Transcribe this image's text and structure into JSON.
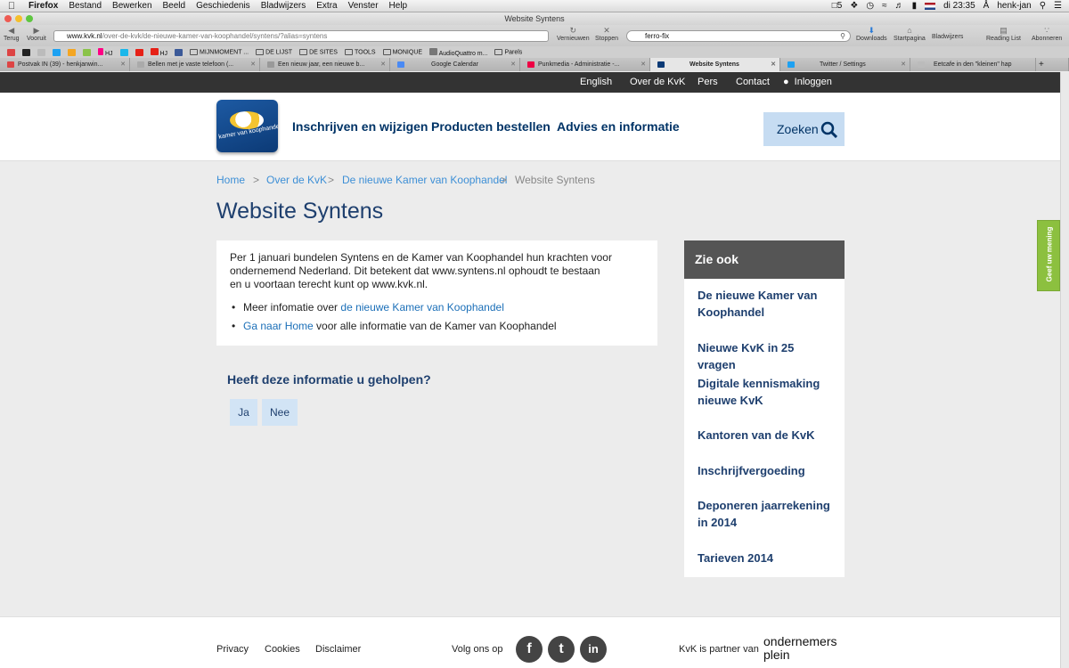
{
  "menubar": {
    "apple": "",
    "items": [
      "Firefox",
      "Bestand",
      "Bewerken",
      "Beeld",
      "Geschiedenis",
      "Bladwijzers",
      "Extra",
      "Venster",
      "Help"
    ],
    "adobe": "5",
    "clock": "di 23:35",
    "user": "henk-jan"
  },
  "window": {
    "title": "Website Syntens"
  },
  "toolbar": {
    "back": "Terug",
    "forward": "Vooruit",
    "url_domain": "www.kvk.nl",
    "url_path": "/over-de-kvk/de-nieuwe-kamer-van-koophandel/syntens/?alias=syntens",
    "reload": "Vernieuwen",
    "stop": "Stoppen",
    "search_value": "ferro-fix",
    "downloads": "Downloads",
    "home": "Startpagina",
    "bookmarks": "Bladwijzers",
    "reading_list": "Reading List",
    "subscribe": "Abonneren"
  },
  "bookmarks_bar": [
    "HJ",
    "HJ",
    "MIJNMOMENT ...",
    "DE LIJST",
    "DE SITES",
    "TOOLS",
    "MONIQUE",
    "AudioQuattro m...",
    "Parels"
  ],
  "tabs": [
    "Postvak IN (39) - henkjanwin...",
    "Bellen met je vaste telefoon (...",
    "Een nieuw jaar, een nieuwe b...",
    "Google Calendar",
    "Punkmedia - Administratie -...",
    "Website Syntens",
    "Twitter / Settings",
    "Eetcafe in den \"kleinen\" hap"
  ],
  "topbar": {
    "english": "English",
    "about": "Over de KvK",
    "press": "Pers",
    "contact": "Contact",
    "login": "Inloggen"
  },
  "logo_text": "kamer van koophandel",
  "nav": {
    "register": "Inschrijven en wijzigen",
    "products": "Producten bestellen",
    "advice": "Advies en informatie",
    "search": "Zoeken"
  },
  "breadcrumb": {
    "home": "Home",
    "about": "Over de KvK",
    "new_kvk": "De nieuwe Kamer van Koophandel",
    "current": "Website Syntens",
    "sep": ">"
  },
  "page_title": "Website Syntens",
  "content": {
    "intro": "Per 1 januari bundelen Syntens en de Kamer van Koophandel hun krachten voor ondernemend Nederland. Dit betekent dat www.syntens.nl ophoudt te bestaan en u voortaan terecht kunt op www.kvk.nl.",
    "bullet1_prefix": "Meer infomatie over ",
    "bullet1_link": "de nieuwe Kamer van Koophandel",
    "bullet2_link": "Ga naar Home",
    "bullet2_suffix": " voor alle informatie van de Kamer van Koophandel"
  },
  "helpful": {
    "question": "Heeft deze informatie u geholpen?",
    "yes": "Ja",
    "no": "Nee"
  },
  "sidebar": {
    "title": "Zie ook",
    "links": [
      "De nieuwe Kamer van Koophandel",
      "Nieuwe KvK in 25 vragen",
      "Digitale kennismaking nieuwe KvK",
      "Kantoren van de KvK",
      "Inschrijfvergoeding",
      "Deponeren jaarrekening in 2014",
      "Tarieven 2014"
    ]
  },
  "feedback": "Geef uw mening",
  "footer": {
    "privacy": "Privacy",
    "cookies": "Cookies",
    "disclaimer": "Disclaimer",
    "follow": "Volg ons op",
    "facebook": "f",
    "twitter": "t",
    "linkedin": "in",
    "partner": "KvK is partner van",
    "partner_logo_1": "ondernemers",
    "partner_logo_2": "plein"
  },
  "colors": {
    "kvk_blue": "#1e3f6e",
    "link_blue": "#3d8fd6",
    "topbar": "#333333",
    "feedback_green": "#8cc03f",
    "search_bg": "#c6dcf2"
  }
}
